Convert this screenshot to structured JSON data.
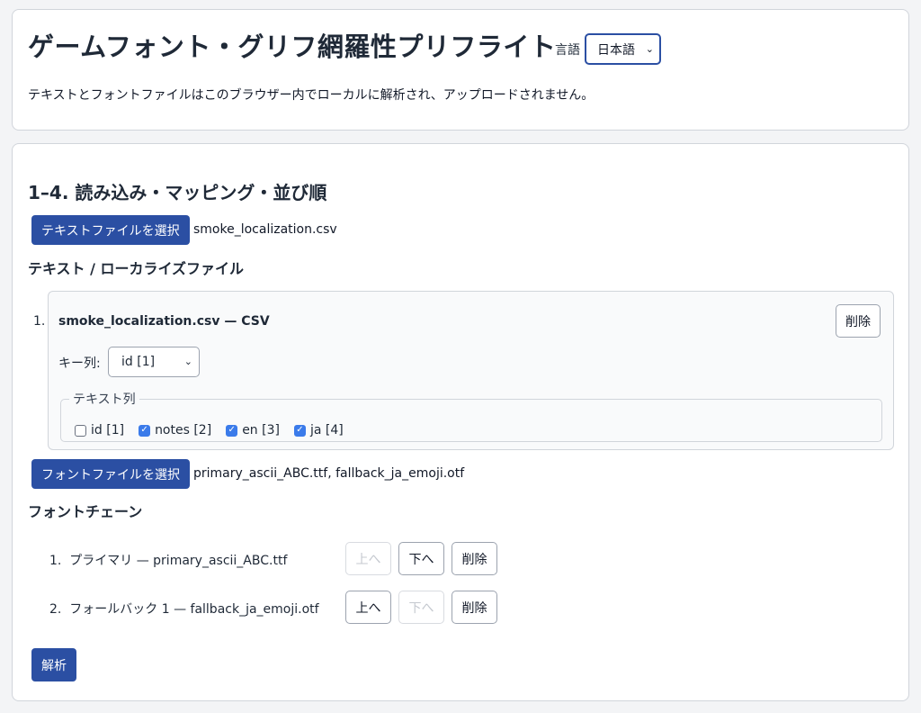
{
  "header": {
    "title": "ゲームフォント・グリフ網羅性プリフライト",
    "language_label": "言語",
    "language_selected": "日本語",
    "privacy_note": "テキストとフォントファイルはこのブラウザー内でローカルに解析され、アップロードされません。"
  },
  "main": {
    "section_title": "1–4. 読み込み・マッピング・並び順",
    "text_file_button": "テキストファイルを選択",
    "text_file_selected": "smoke_localization.csv",
    "text_files_heading": "テキスト / ローカライズファイル",
    "text_files": [
      {
        "index": "1.",
        "title": "smoke_localization.csv — CSV",
        "remove_label": "削除",
        "key_column_label": "キー列:",
        "key_column_selected": "id [1]",
        "text_columns_legend": "テキスト列",
        "columns": [
          {
            "label": "id [1]",
            "checked": false
          },
          {
            "label": "notes [2]",
            "checked": true
          },
          {
            "label": "en [3]",
            "checked": true
          },
          {
            "label": "ja [4]",
            "checked": true
          }
        ]
      }
    ],
    "font_file_button": "フォントファイルを選択",
    "font_files_selected": "primary_ascii_ABC.ttf, fallback_ja_emoji.otf",
    "font_chain_heading": "フォントチェーン",
    "font_chain": [
      {
        "index": "1.",
        "label": "プライマリ — primary_ascii_ABC.ttf",
        "up": "上へ",
        "down": "下へ",
        "remove": "削除",
        "up_disabled": true,
        "down_disabled": false
      },
      {
        "index": "2.",
        "label": "フォールバック 1 — fallback_ja_emoji.otf",
        "up": "上へ",
        "down": "下へ",
        "remove": "削除",
        "up_disabled": false,
        "down_disabled": true
      }
    ],
    "analyze_button": "解析"
  },
  "colors": {
    "primary_button": "#2b4fa3",
    "checkbox_checked": "#3b7bea",
    "page_background": "#f3f4f6"
  },
  "icons": {
    "select_arrow": "chevron-down-icon",
    "checkbox_check": "check-icon"
  }
}
